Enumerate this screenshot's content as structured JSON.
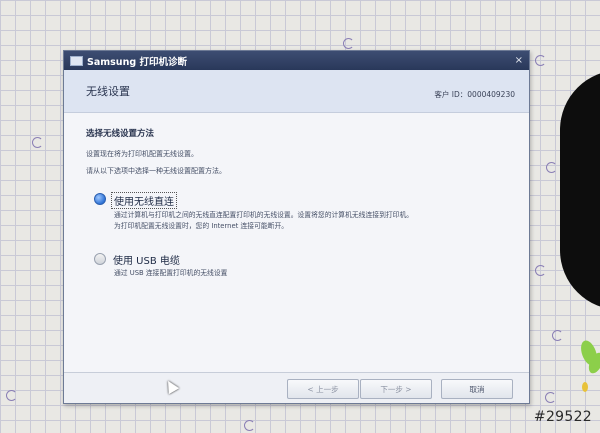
{
  "window": {
    "title": "Samsung 打印机诊断",
    "close_symbol": "×"
  },
  "header": {
    "title": "无线设置",
    "customer_id": "客户 ID：0000409230"
  },
  "content": {
    "section_title": "选择无线设置方法",
    "desc1": "设置现在将为打印机配置无线设置。",
    "desc2": "请从以下选项中选择一种无线设置配置方法。"
  },
  "options": [
    {
      "label": "使用无线直连",
      "selected": true,
      "desc_line1": "通过计算机与打印机之间的无线直连配置打印机的无线设置。设置将您的计算机无线连接到打印机。",
      "desc_line2": "为打印机配置无线设置时，您的 Internet 连接可能断开。"
    },
    {
      "label": "使用 USB 电缆",
      "selected": false,
      "desc_line1": "通过 USB 连接配置打印机的无线设置"
    }
  ],
  "buttons": {
    "prev": "< 上一步",
    "next": "下一步 >",
    "cancel": "取消"
  },
  "photo_tag": "#29522",
  "colors": {
    "titlebar": "#29385a",
    "header_band": "#dde4f2",
    "radio_selected": "#2f73d6"
  }
}
